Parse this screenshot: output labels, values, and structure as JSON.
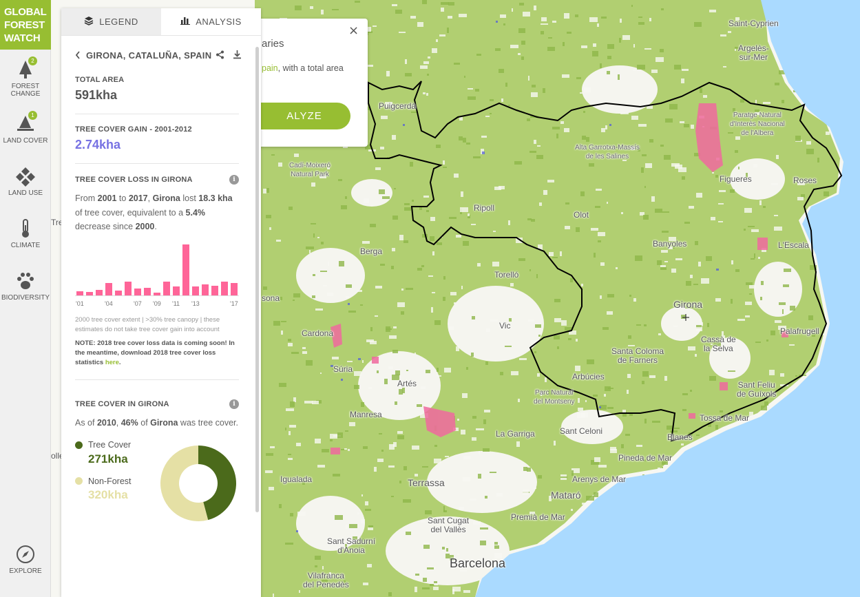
{
  "app": {
    "logo_lines": [
      "GLOBAL",
      "FOREST",
      "WATCH"
    ],
    "brand_color": "#97be32"
  },
  "menu": {
    "items": [
      {
        "label_lines": [
          "FOREST",
          "CHANGE"
        ],
        "icon": "forest-change-icon",
        "badge": "2"
      },
      {
        "label_lines": [
          "LAND COVER"
        ],
        "icon": "land-cover-icon",
        "badge": "1"
      },
      {
        "label_lines": [
          "LAND USE"
        ],
        "icon": "land-use-icon"
      },
      {
        "label_lines": [
          "CLIMATE"
        ],
        "icon": "thermometer-icon"
      },
      {
        "label_lines": [
          "BIODIVERSITY"
        ],
        "icon": "paw-icon"
      },
      {
        "label_lines": [
          "EXPLORE"
        ],
        "icon": "compass-icon"
      }
    ]
  },
  "panel": {
    "tabs": [
      {
        "label": "LEGEND",
        "icon": "layers-icon",
        "active": false
      },
      {
        "label": "ANALYSIS",
        "icon": "bar-chart-icon",
        "active": true
      }
    ],
    "location": "GIRONA, CATALUÑA, SPAIN",
    "total_area": {
      "label": "TOTAL AREA",
      "value": "591kha"
    },
    "gain": {
      "label": "TREE COVER GAIN - 2001-2012",
      "value": "2.74kha",
      "color": "#7772e3"
    },
    "loss": {
      "title": "TREE COVER LOSS IN GIRONA",
      "sentence": {
        "p1": "From ",
        "start": "2001",
        "p2": " to ",
        "end": "2017",
        "p3": ", ",
        "region": "Girona",
        "p4": " lost ",
        "amount": "18.3 kha",
        "p5": " of tree cover, equivalent to a ",
        "percent": "5.4%",
        "p6": " decrease since ",
        "base": "2000",
        "p7": "."
      },
      "note": "2000 tree cover extent | >30% tree canopy | these estimates do not take tree cover gain into account",
      "note_bold": "NOTE: 2018 tree cover loss data is coming soon! In the meantime, download 2018 tree cover loss statistics ",
      "note_link": "here",
      "note_end": "."
    },
    "cover": {
      "title": "TREE COVER IN GIRONA",
      "sentence": {
        "p1": "As of ",
        "year": "2010",
        "p2": ", ",
        "percent": "46%",
        "p3": " of ",
        "region": "Girona",
        "p4": " was tree cover."
      },
      "legend": [
        {
          "label": "Tree Cover",
          "value": "271kha",
          "color": "#4b6a1b"
        },
        {
          "label": "Non-Forest",
          "value": "320kha",
          "color": "#e5e0a5"
        }
      ]
    }
  },
  "chart_data": {
    "type": "bar",
    "categories": [
      "2001",
      "2002",
      "2003",
      "2004",
      "2005",
      "2006",
      "2007",
      "2008",
      "2009",
      "2010",
      "2011",
      "2012",
      "2013",
      "2014",
      "2015",
      "2016",
      "2017"
    ],
    "values": [
      0.4,
      0.35,
      0.55,
      1.25,
      0.5,
      1.45,
      0.7,
      0.75,
      0.25,
      1.4,
      0.9,
      5.3,
      0.9,
      1.1,
      0.95,
      1.4,
      1.25
    ],
    "tick_labels": [
      "'01",
      "'04",
      "'07",
      "'09",
      "'11",
      "'13",
      "'17"
    ],
    "tick_indices": [
      0,
      3,
      6,
      8,
      10,
      12,
      16
    ],
    "highlight_color": "#fe6598",
    "ylim": [
      0,
      5.5
    ],
    "units": "kha"
  },
  "popup": {
    "title_fragment": "aries",
    "text_link_fragment": "pain",
    "text_rest": ", with a total area",
    "button_label": "ALYZE",
    "close": "×"
  },
  "map": {
    "places": [
      {
        "name": "Saint-Cyprien",
        "cls": ""
      },
      {
        "name": "Argelès-\nsur-Mer",
        "cls": ""
      },
      {
        "name": "Paratge Natural\nd'Interès Nacional\nde l'Albera",
        "cls": "small"
      },
      {
        "name": "Puigcerdà",
        "cls": ""
      },
      {
        "name": "Alta Garrotxa-Massís\nde les Salines",
        "cls": "small"
      },
      {
        "name": "Cadí-Moixeró\nNatural Park",
        "cls": "small"
      },
      {
        "name": "Figueres",
        "cls": ""
      },
      {
        "name": "Roses",
        "cls": ""
      },
      {
        "name": "Ripoll",
        "cls": ""
      },
      {
        "name": "Olot",
        "cls": ""
      },
      {
        "name": "Banyoles",
        "cls": ""
      },
      {
        "name": "L'Escala",
        "cls": ""
      },
      {
        "name": "Berga",
        "cls": ""
      },
      {
        "name": "Torelló",
        "cls": ""
      },
      {
        "name": "Girona",
        "cls": "mid"
      },
      {
        "name": "Vic",
        "cls": ""
      },
      {
        "name": "Cassà de\nla Selva",
        "cls": ""
      },
      {
        "name": "Palafrugell",
        "cls": ""
      },
      {
        "name": "Cardona",
        "cls": ""
      },
      {
        "name": "Santa Coloma\nde Farners",
        "cls": ""
      },
      {
        "name": "Súria",
        "cls": ""
      },
      {
        "name": "Artés",
        "cls": ""
      },
      {
        "name": "Arbúcies",
        "cls": ""
      },
      {
        "name": "Sant Feliu\nde Guíxols",
        "cls": ""
      },
      {
        "name": "Parc Natural\ndel Montseny",
        "cls": "small"
      },
      {
        "name": "Manresa",
        "cls": ""
      },
      {
        "name": "Tossa de Mar",
        "cls": ""
      },
      {
        "name": "La Garriga",
        "cls": ""
      },
      {
        "name": "Sant Celoni",
        "cls": ""
      },
      {
        "name": "Blanes",
        "cls": ""
      },
      {
        "name": "Pineda de Mar",
        "cls": ""
      },
      {
        "name": "Igualada",
        "cls": ""
      },
      {
        "name": "Terrassa",
        "cls": "mid"
      },
      {
        "name": "Arenys de Mar",
        "cls": ""
      },
      {
        "name": "Mataró",
        "cls": "mid"
      },
      {
        "name": "Premià de Mar",
        "cls": ""
      },
      {
        "name": "Sant Cugat\ndel Vallès",
        "cls": ""
      },
      {
        "name": "Sant Sadurní\nd'Anoia",
        "cls": ""
      },
      {
        "name": "Barcelona",
        "cls": "big"
      },
      {
        "name": "Vilafranca\ndel Penedès",
        "cls": ""
      },
      {
        "name": "sona",
        "cls": ""
      },
      {
        "name": "Tre",
        "cls": ""
      },
      {
        "name": "olle",
        "cls": ""
      }
    ]
  }
}
